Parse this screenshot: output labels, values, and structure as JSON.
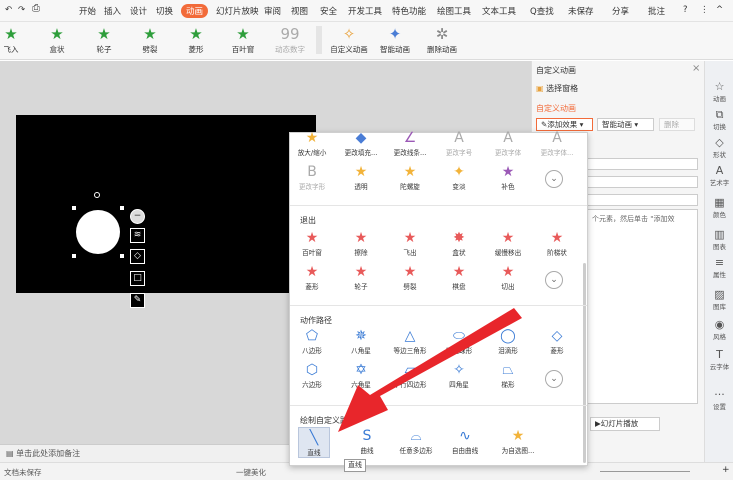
{
  "menubar": {
    "undo": "↶",
    "redo": "↷",
    "items": [
      "开始",
      "插入",
      "设计",
      "切换",
      "动画",
      "幻灯片放映",
      "审阅",
      "视图",
      "安全",
      "开发工具",
      "特色功能",
      "绘图工具",
      "文本工具"
    ],
    "search": "Q查找",
    "unsaved": "未保存",
    "share": "分享",
    "comment": "批注",
    "help": "?"
  },
  "ribbon": {
    "items": [
      "飞入",
      "盒状",
      "轮子",
      "劈裂",
      "菱形",
      "百叶窗",
      "动态数字",
      "自定义动画",
      "智能动画",
      "删除动画"
    ],
    "big_number": "99"
  },
  "right_panel": {
    "title": "自定义动画",
    "select_pane": "选择窗格",
    "section": "自定义动画",
    "add_effect": "添加效果",
    "smart_anim": "智能动画",
    "delete": "删除",
    "hint": "个元素，然后单击 \"添加效",
    "play": "幻灯片播放"
  },
  "right_bar": [
    "动画",
    "切换",
    "形状",
    "艺术字",
    "颜色",
    "图表",
    "属性",
    "图库",
    "风格",
    "云字体",
    "设置"
  ],
  "popup": {
    "row_top1": [
      "放大/缩小",
      "更改填充...",
      "更改线条...",
      "更改字号",
      "更改字体",
      "更改字体..."
    ],
    "row_top2": [
      "更改字形",
      "透明",
      "陀螺旋",
      "变淡",
      "补色"
    ],
    "exit_title": "退出",
    "exit1": [
      "百叶窗",
      "擦除",
      "飞出",
      "盒状",
      "缓慢移出",
      "阶梯状"
    ],
    "exit2": [
      "菱形",
      "轮子",
      "劈裂",
      "棋盘",
      "切出"
    ],
    "path_title": "动作路径",
    "path1": [
      "八边形",
      "八角星",
      "等边三角形",
      "橄榄球形",
      "泪滴形",
      "菱形"
    ],
    "path2": [
      "六边形",
      "六角星",
      "平行四边形",
      "四角星",
      "梯形"
    ],
    "custom_title": "绘制自定义路径",
    "custom": [
      "直线",
      "曲线",
      "任意多边形",
      "自由曲线",
      "为自选图..."
    ],
    "tooltip": "直线"
  },
  "notes": "单击此处添加备注",
  "status": {
    "left": "文档未保存",
    "mid": "一键美化"
  },
  "colors": {
    "accent": "#f26b3a",
    "arrow": "#e8262b"
  }
}
